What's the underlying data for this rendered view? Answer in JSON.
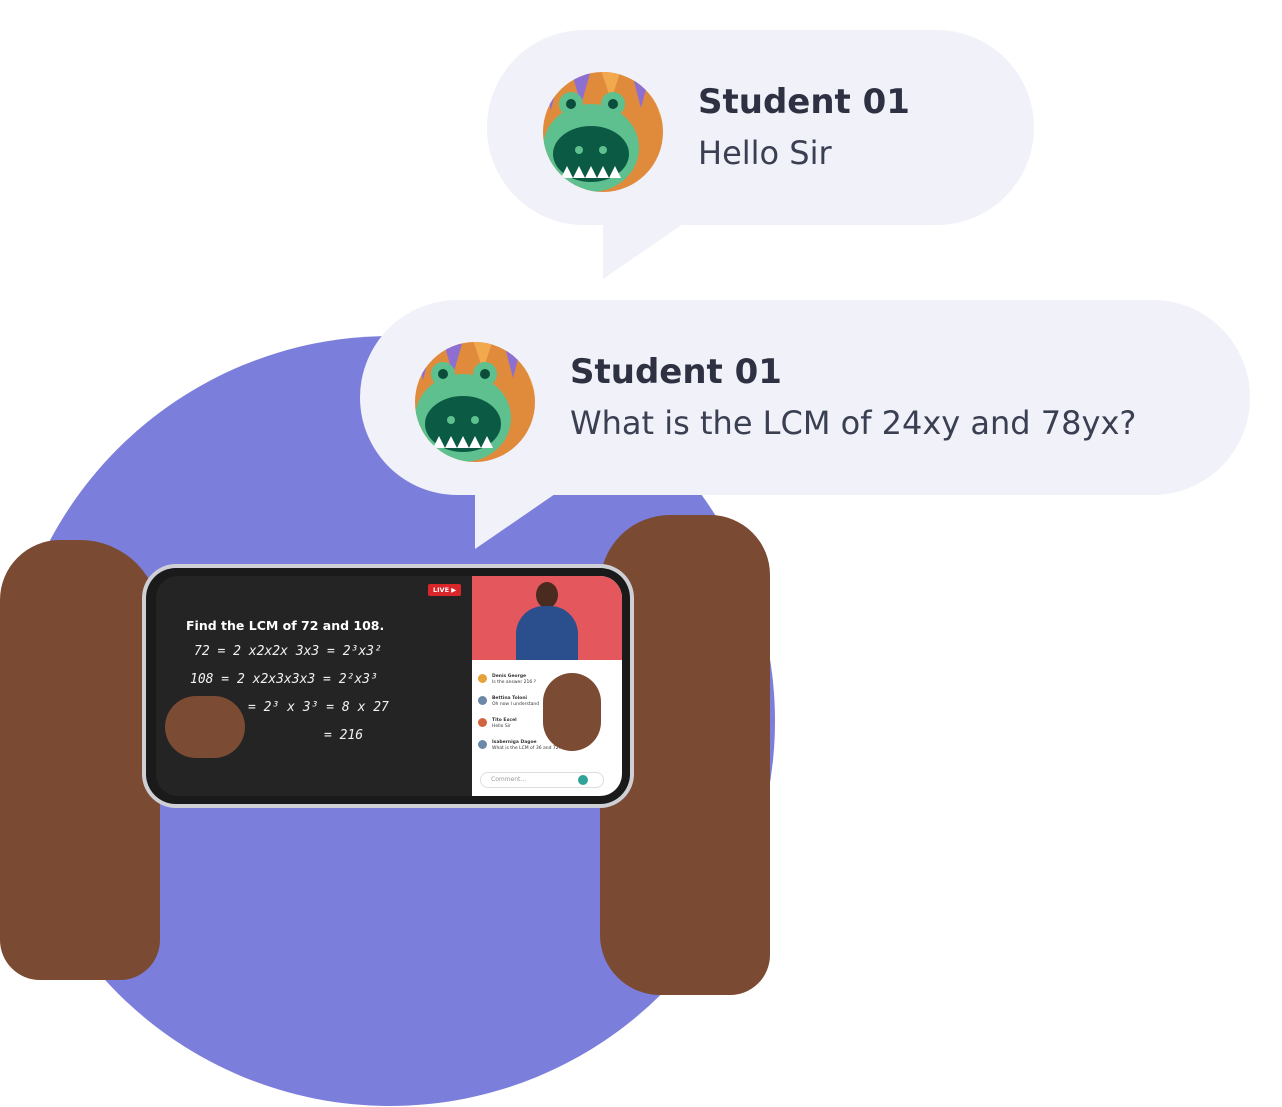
{
  "bubbles": [
    {
      "name": "Student 01",
      "message": "Hello Sir"
    },
    {
      "name": "Student 01",
      "message": "What is the LCM of 24xy and 78yx?"
    }
  ],
  "avatar_icon": "monster-avatar-icon",
  "phone": {
    "live_label": "LIVE ▶",
    "problem": "Find the LCM of 72 and 108.",
    "work_lines": [
      "72 = 2 x2x2x 3x3 = 2³x3²",
      "108 = 2 x2x3x3x3 = 2²x3³",
      "= 2³ x 3³ = 8 x 27",
      "= 216"
    ],
    "comments": [
      {
        "name": "Denis George",
        "text": "Is the answer 216 ?"
      },
      {
        "name": "Bettina Toloni",
        "text": "Oh now I understand"
      },
      {
        "name": "Tito Excel",
        "text": "Hello Sir"
      },
      {
        "name": "Isaberniga Dagoe",
        "text": "What is the LCM of 36 and 72?"
      }
    ],
    "comment_placeholder": "Comment..."
  },
  "colors": {
    "circle": "#7b7edb",
    "bubble": "#f0f1f9",
    "live": "#d8262b",
    "send": "#2fa39a"
  }
}
